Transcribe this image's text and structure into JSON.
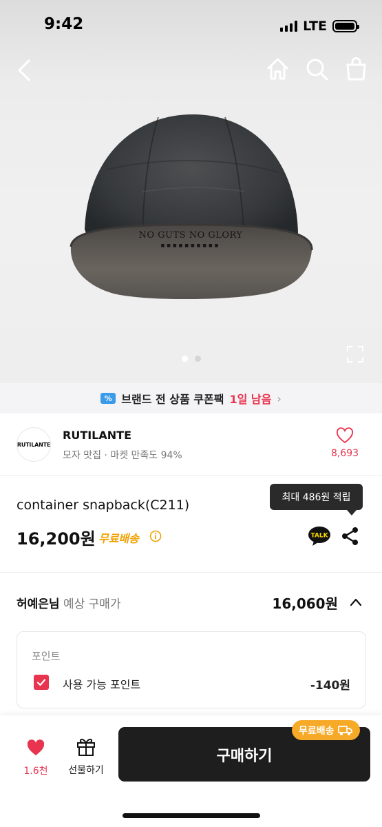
{
  "status_bar": {
    "time": "9:42",
    "network": "LTE"
  },
  "nav": {
    "back": "back-arrow",
    "icons": [
      "home-icon",
      "search-icon",
      "shopping-bag-icon"
    ]
  },
  "hero": {
    "image_label": "container snapback cap photo",
    "cap_print": "NO GUTS NO GLORY",
    "page_dots": 2,
    "active_dot": 1
  },
  "coupon_bar": {
    "text": "브랜드 전 상품 쿠폰팩",
    "highlight": "1일 남음"
  },
  "brand": {
    "logo_text": "RUTILANTE",
    "name": "RUTILANTE",
    "subtitle": "모자 맛집 · 마켓 만족도 94%",
    "like_count": "8,693"
  },
  "product": {
    "tooltip": "최대 486원 적립",
    "name": "container snapback(C211)",
    "price": "16,200원",
    "free_shipping": "무료배송",
    "talk_label": "TALK"
  },
  "expected_price": {
    "user": "허예은님",
    "label": "예상 구매가",
    "value": "16,060원"
  },
  "points": {
    "title": "포인트",
    "option_label": "사용 가능 포인트",
    "option_value": "-140원",
    "checked": true
  },
  "bottom_bar": {
    "like_count": "1.6천",
    "gift_label": "선물하기",
    "buy_label": "구매하기",
    "shipping_badge": "무료배송"
  },
  "colors": {
    "accent_red": "#e8344e",
    "badge_orange": "#f7a928",
    "buy_button": "#1e1e1e",
    "coupon_blue": "#3b9be8"
  }
}
